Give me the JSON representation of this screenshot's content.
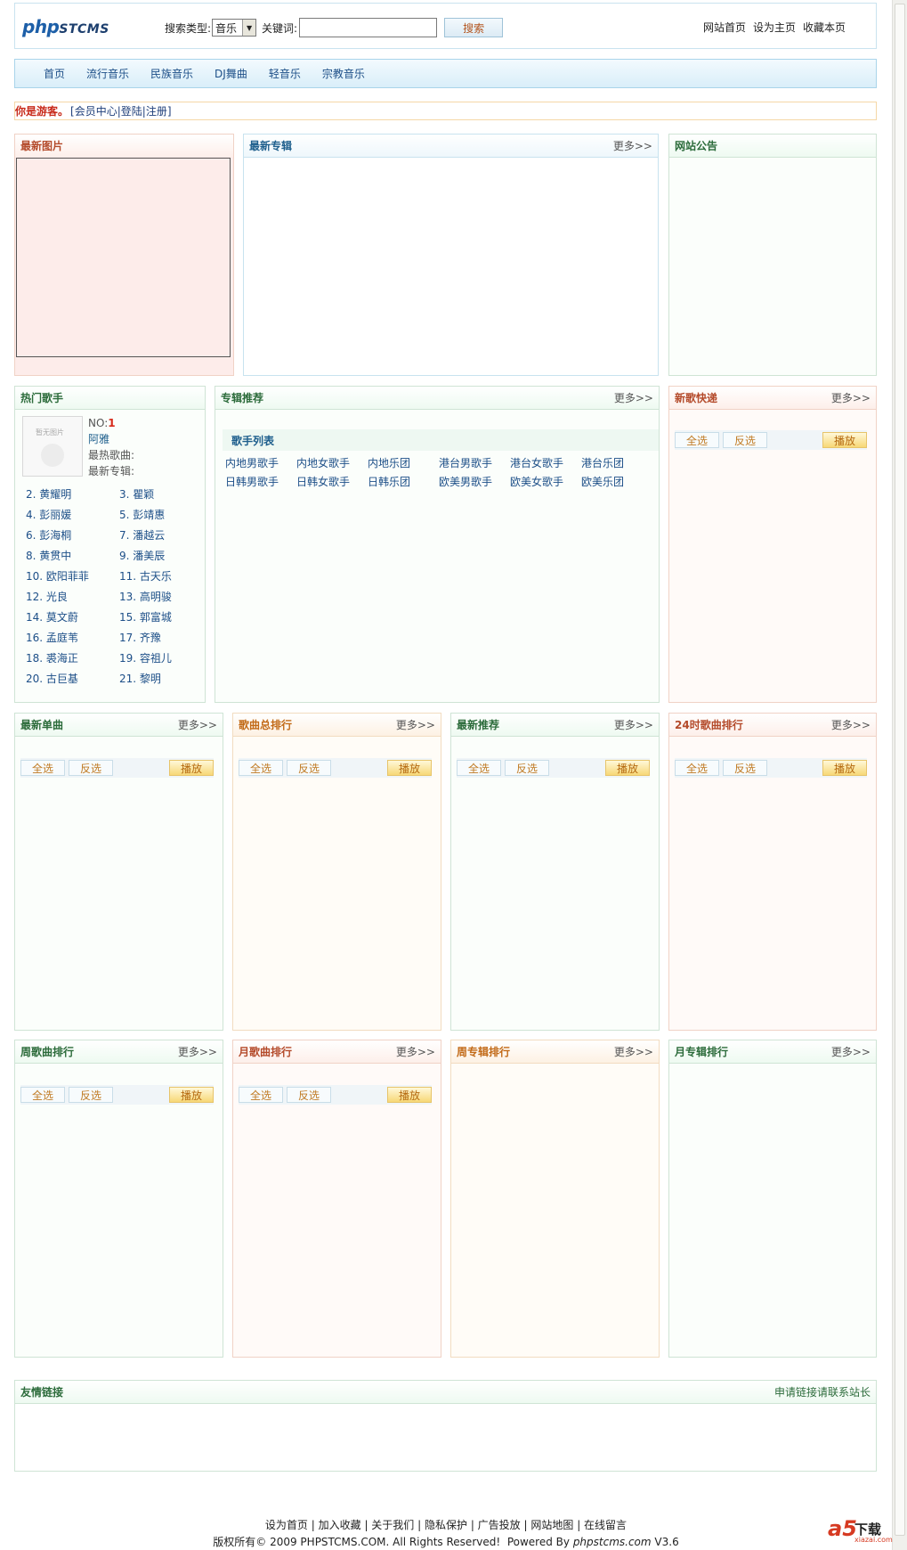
{
  "header": {
    "logo_main": "php",
    "logo_sub": "STCMS",
    "search_type_label": "搜索类型:",
    "search_type_value": "音乐",
    "keyword_label": "关键词:",
    "search_button": "搜索",
    "top_links": [
      "网站首页",
      "设为主页",
      "收藏本页"
    ]
  },
  "nav": [
    "首页",
    "流行音乐",
    "民族音乐",
    "DJ舞曲",
    "轻音乐",
    "宗教音乐"
  ],
  "userbar": {
    "guest": "你是游客。",
    "open": "[",
    "links": [
      "会员中心",
      "登陆",
      "注册"
    ],
    "sep": "|",
    "close": "]"
  },
  "panels": {
    "latest_pics": "最新图片",
    "latest_albums": "最新专辑",
    "announcement": "网站公告",
    "hot_singers": "热门歌手",
    "album_recommend": "专辑推荐",
    "new_songs": "新歌快递",
    "latest_singles": "最新单曲",
    "song_rank": "歌曲总排行",
    "latest_recommend": "最新推荐",
    "rank_24h": "24时歌曲排行",
    "week_song_rank": "周歌曲排行",
    "month_song_rank": "月歌曲排行",
    "week_album_rank": "周专辑排行",
    "month_album_rank": "月专辑排行",
    "friend_links": "友情链接",
    "apply_link": "申请链接请联系站长"
  },
  "common": {
    "more": "更多>>",
    "select_all": "全选",
    "invert": "反选",
    "play": "播放"
  },
  "hot_singer": {
    "photo_label": "暂无图片",
    "no_label": "NO:",
    "no_value": "1",
    "name": "阿雅",
    "hot_song_label": "最热歌曲:",
    "new_album_label": "最新专辑:",
    "list": [
      "2. 黄耀明",
      "3. 瞿颖",
      "4. 彭丽媛",
      "5. 彭靖惠",
      "6. 彭海桐",
      "7. 潘越云",
      "8. 黄贯中",
      "9. 潘美辰",
      "10. 欧阳菲菲",
      "11. 古天乐",
      "12. 光良",
      "13. 高明骏",
      "14. 莫文蔚",
      "15. 郭富城",
      "16. 孟庭苇",
      "17. 齐豫",
      "18. 裘海正",
      "19. 容祖儿",
      "20. 古巨基",
      "21. 黎明"
    ]
  },
  "artist_list": {
    "title": "歌手列表",
    "items": [
      "内地男歌手",
      "内地女歌手",
      "内地乐团",
      "港台男歌手",
      "港台女歌手",
      "港台乐团",
      "日韩男歌手",
      "日韩女歌手",
      "日韩乐团",
      "欧美男歌手",
      "欧美女歌手",
      "欧美乐团"
    ]
  },
  "footer": {
    "links": [
      "设为首页",
      "加入收藏",
      "关于我们",
      "隐私保护",
      "广告投放",
      "网站地图",
      "在线留言"
    ],
    "sep": " | ",
    "copyright": "版权所有© 2009 PHPSTCMS.COM. All Rights Reserved!",
    "powered_label": "Powered By",
    "powered_site": "phpstcms.com",
    "version": "V3.6"
  },
  "watermark": {
    "mark": "a5",
    "cn": "下载",
    "site": "xiazai.com"
  }
}
